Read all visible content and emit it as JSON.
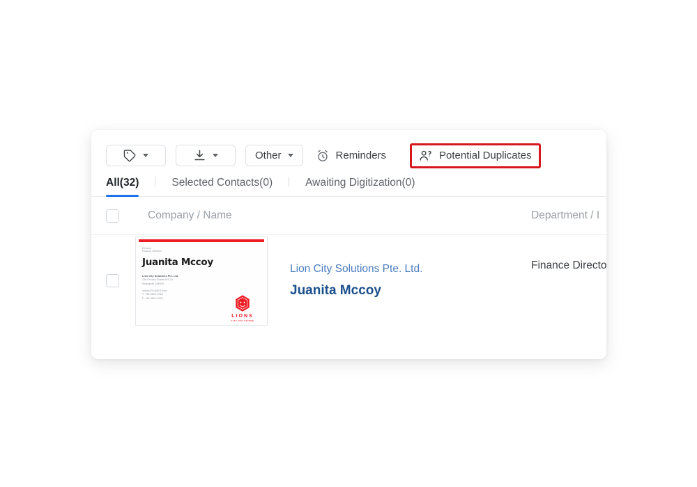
{
  "panel": {
    "toolbar": {
      "tag_button": {
        "icon": "tag-icon",
        "caret": "chevron-down-icon"
      },
      "download_button": {
        "icon": "download-icon",
        "caret": "chevron-down-icon"
      },
      "other_button": {
        "label": "Other",
        "caret": "chevron-down-icon"
      },
      "reminders_button": {
        "label": "Reminders",
        "icon": "alarm-clock-icon"
      },
      "potential_duplicates_button": {
        "label": "Potential Duplicates",
        "icon": "person-question-icon",
        "highlight_color": "#d6171c"
      }
    },
    "tabs": [
      {
        "label": "All(32)",
        "active": true
      },
      {
        "label": "Selected Contacts(0)",
        "active": false
      },
      {
        "label": "Awaiting Digitization(0)",
        "active": false
      }
    ],
    "tabs_active_color": "#1a73e8",
    "table": {
      "columns": {
        "select_all": "",
        "company_name": "Company / Name",
        "department": "Department / I"
      },
      "rows": [
        {
          "company": "Lion City Solutions Pte. Ltd.",
          "name": "Juanita Mccoy",
          "department": "Finance Directo",
          "card": {
            "title_line_1": "Director",
            "title_line_2": "Finance Director",
            "name": "Juanita Mccoy",
            "company": "Lion City Solutions Pte. Ltd.",
            "address_line_1": "138 Privacy Street #01-01",
            "address_line_2": "Singapore 188400",
            "email": "donna20240813.com",
            "phone": "T. +65-6821-0002",
            "fax": "F. +65-6821-6002",
            "logo_word": "LIONS",
            "logo_sub": "CITY SOLUTIONS",
            "accent_color": "#ee1c25"
          }
        }
      ]
    }
  }
}
